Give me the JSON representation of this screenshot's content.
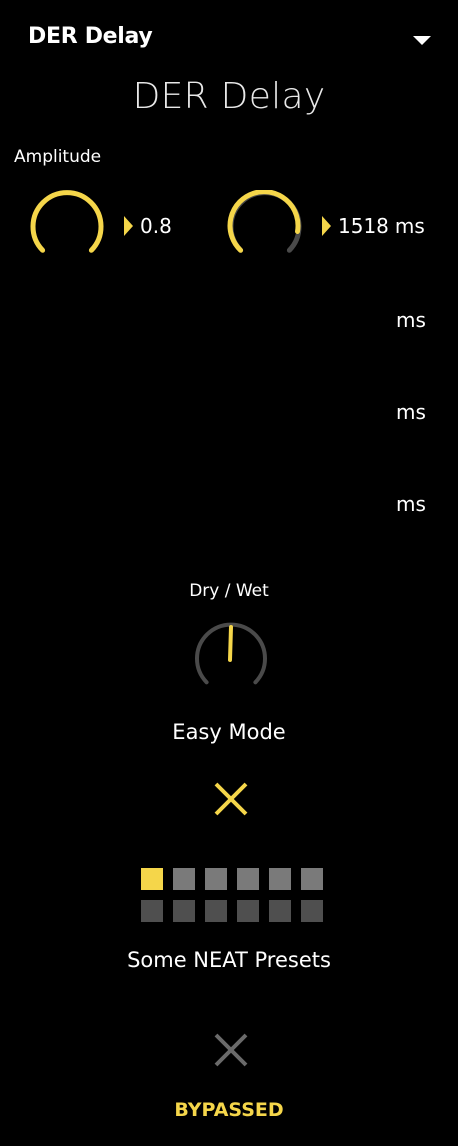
{
  "header": {
    "title": "DER Delay"
  },
  "plugin_name": "DER Delay",
  "amplitude": {
    "label": "Amplitude",
    "value": "0.8",
    "level": 0.8
  },
  "delay": {
    "value": "1518",
    "unit": "ms"
  },
  "extra_units": [
    "ms",
    "ms",
    "ms"
  ],
  "dry_wet": {
    "label": "Dry / Wet",
    "level": 0.5
  },
  "easy_mode": {
    "label": "Easy Mode"
  },
  "presets": {
    "label": "Some NEAT Presets",
    "rows": 2,
    "cols": 6,
    "active_index": 0
  },
  "bypass": {
    "label": "BYPASSED"
  },
  "colors": {
    "accent": "#f5d64a",
    "track": "#4a4a4a",
    "background": "#000000"
  }
}
